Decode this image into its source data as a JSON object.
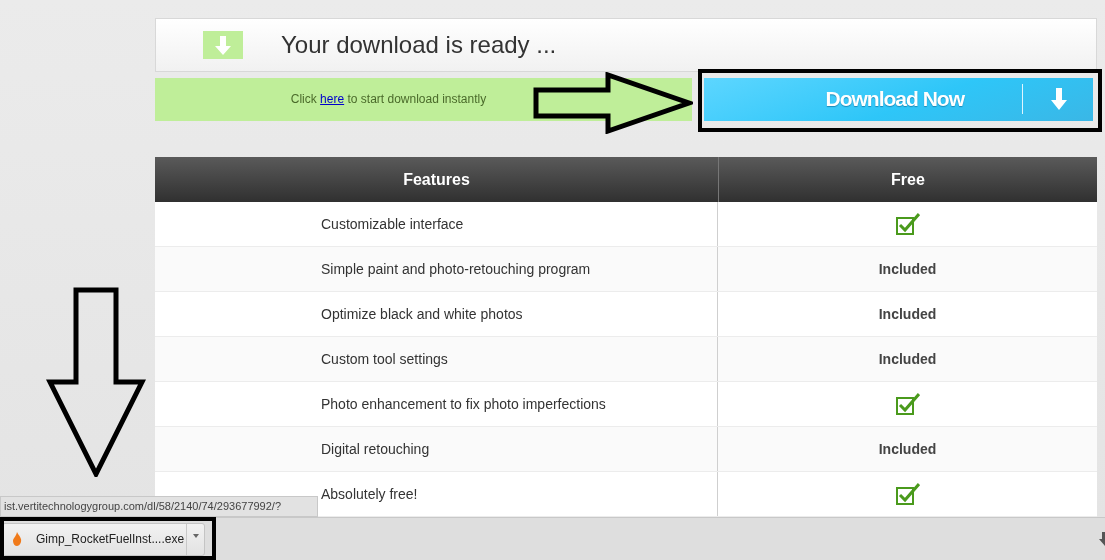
{
  "header": {
    "title": "Your download is ready ..."
  },
  "prompt": {
    "before": "Click ",
    "link": "here",
    "after": " to start download instantly"
  },
  "download_button": {
    "label": "Download Now"
  },
  "table": {
    "columns": [
      "Features",
      "Free"
    ],
    "rows": [
      {
        "feature": "Customizable interface",
        "kind": "check"
      },
      {
        "feature": "Simple paint and photo-retouching program",
        "kind": "text",
        "free": "Included"
      },
      {
        "feature": "Optimize black and white photos",
        "kind": "text",
        "free": "Included"
      },
      {
        "feature": "Custom tool settings",
        "kind": "text",
        "free": "Included"
      },
      {
        "feature": "Photo enhancement to fix photo imperfections",
        "kind": "check"
      },
      {
        "feature": "Digital retouching",
        "kind": "text",
        "free": "Included"
      },
      {
        "feature": "Absolutely free!",
        "kind": "check"
      }
    ]
  },
  "status_url": "ist.vertitechnologygroup.com/dl/58/2140/74/293677992/?",
  "download_bar": {
    "items": [
      {
        "filename": "Gimp_RocketFuelInst....exe"
      }
    ]
  }
}
